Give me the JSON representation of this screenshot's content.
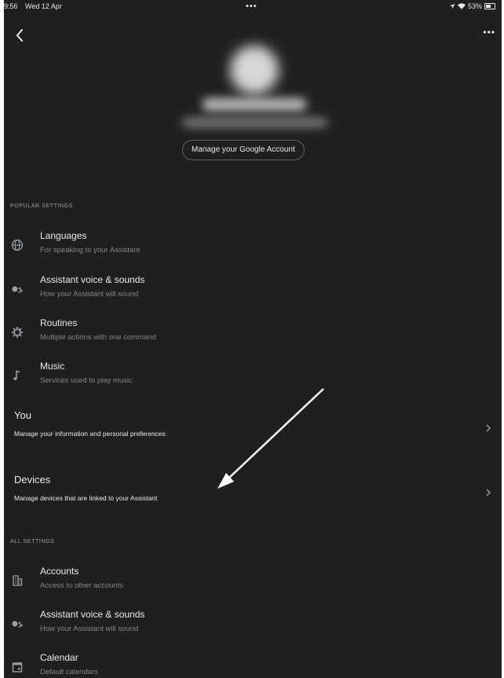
{
  "status_bar": {
    "time": "09:56",
    "date": "Wed 12 Apr",
    "center_dots": "•••",
    "battery": "53%"
  },
  "header": {
    "back_icon": "chevron-left-icon",
    "more_label": "•••"
  },
  "profile": {
    "manage_account_label": "Manage your Google Account"
  },
  "popular_settings": {
    "header": "POPULAR SETTINGS",
    "items": [
      {
        "icon": "globe-icon",
        "title": "Languages",
        "subtitle": "For speaking to your Assistant"
      },
      {
        "icon": "assistant-icon",
        "title": "Assistant voice & sounds",
        "subtitle": "How your Assistant will sound"
      },
      {
        "icon": "routines-icon",
        "title": "Routines",
        "subtitle": "Multiple actions with one command"
      },
      {
        "icon": "music-note-icon",
        "title": "Music",
        "subtitle": "Services used to play music"
      }
    ]
  },
  "you_row": {
    "title": "You",
    "subtitle": "Manage your information and personal preferences"
  },
  "devices_row": {
    "title": "Devices",
    "subtitle": "Manage devices that are linked to your Assistant"
  },
  "all_settings": {
    "header": "ALL SETTINGS",
    "items": [
      {
        "icon": "accounts-icon",
        "title": "Accounts",
        "subtitle": "Access to other accounts"
      },
      {
        "icon": "assistant-icon",
        "title": "Assistant voice & sounds",
        "subtitle": "How your Assistant will sound"
      },
      {
        "icon": "calendar-icon",
        "title": "Calendar",
        "subtitle": "Default calendars"
      }
    ]
  },
  "colors": {
    "background": "#1f1f1f",
    "text_primary": "#e8eaed",
    "text_secondary": "#80868b",
    "annotation_arrow": "#ffffff"
  }
}
